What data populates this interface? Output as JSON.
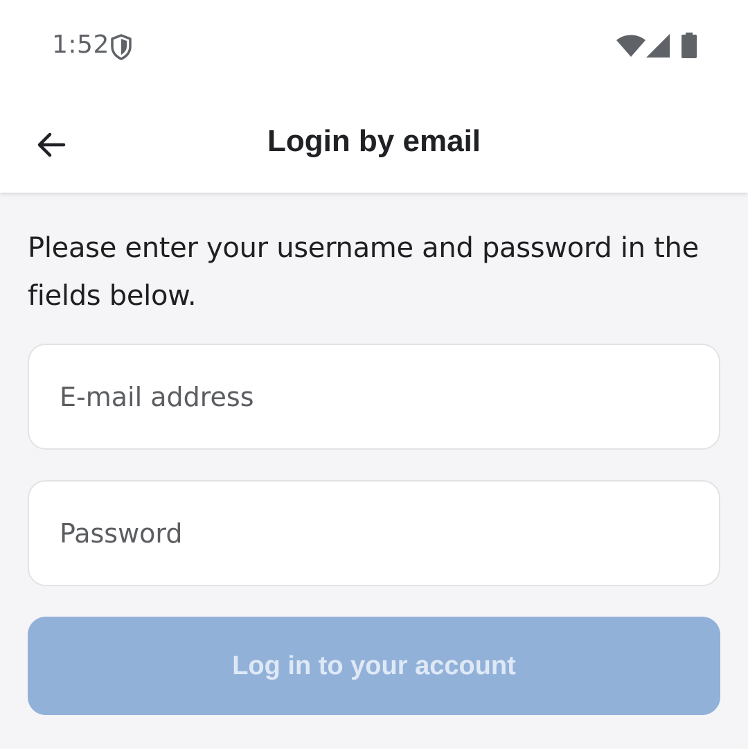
{
  "status_bar": {
    "time": "1:52",
    "icons": [
      "shield-icon",
      "wifi-icon",
      "signal-icon",
      "battery-icon"
    ]
  },
  "app_bar": {
    "title": "Login by email",
    "back_icon": "arrow-left-icon"
  },
  "form": {
    "intro_text": "Please enter your username and password in the fields below.",
    "email": {
      "placeholder": "E-mail address",
      "value": ""
    },
    "password": {
      "placeholder": "Password",
      "value": ""
    },
    "submit_label": "Log in to your account",
    "submit_enabled": false
  },
  "colors": {
    "background": "#f5f5f8",
    "button_disabled": "#92b1d9",
    "button_text_disabled": "#dfe9f6",
    "title_text": "#202124"
  }
}
